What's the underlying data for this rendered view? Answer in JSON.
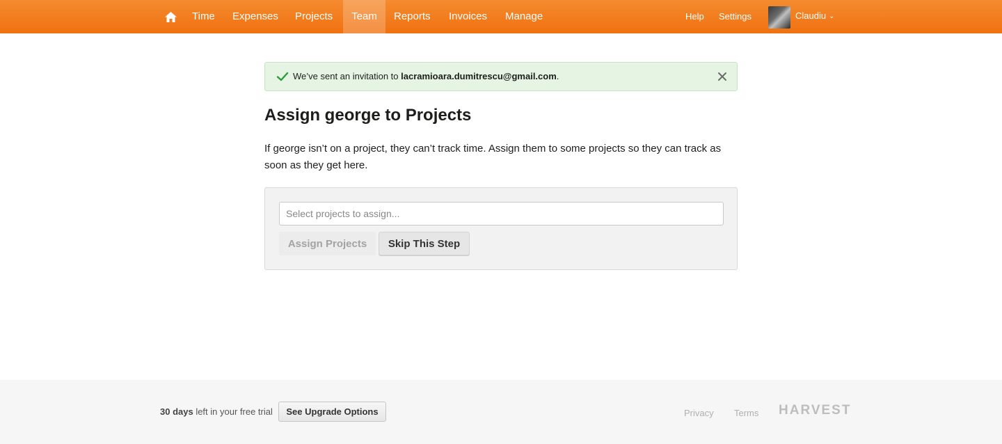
{
  "nav": {
    "items": [
      {
        "label": "Time",
        "active": false
      },
      {
        "label": "Expenses",
        "active": false
      },
      {
        "label": "Projects",
        "active": false
      },
      {
        "label": "Team",
        "active": true
      },
      {
        "label": "Reports",
        "active": false
      },
      {
        "label": "Invoices",
        "active": false
      },
      {
        "label": "Manage",
        "active": false
      }
    ],
    "help": "Help",
    "settings": "Settings",
    "user": "Claudiu"
  },
  "flash": {
    "prefix": "We’ve sent an invitation to ",
    "email": "lacramioara.dumitrescu@gmail.com",
    "suffix": "."
  },
  "page": {
    "title": "Assign george to Projects",
    "description": "If george isn’t on a project, they can’t track time. Assign them to some projects so they can track as soon as they get here."
  },
  "form": {
    "placeholder": "Select projects to assign...",
    "assign_label": "Assign Projects",
    "skip_label": "Skip This Step"
  },
  "footer": {
    "trial_days": "30 days",
    "trial_text": " left in your free trial",
    "upgrade_label": "See Upgrade Options",
    "privacy": "Privacy",
    "terms": "Terms",
    "logo": "HARVEST"
  },
  "colors": {
    "brand": "#f07110",
    "success_bg": "#e6f4e3",
    "success_icon": "#2e9a3a"
  }
}
